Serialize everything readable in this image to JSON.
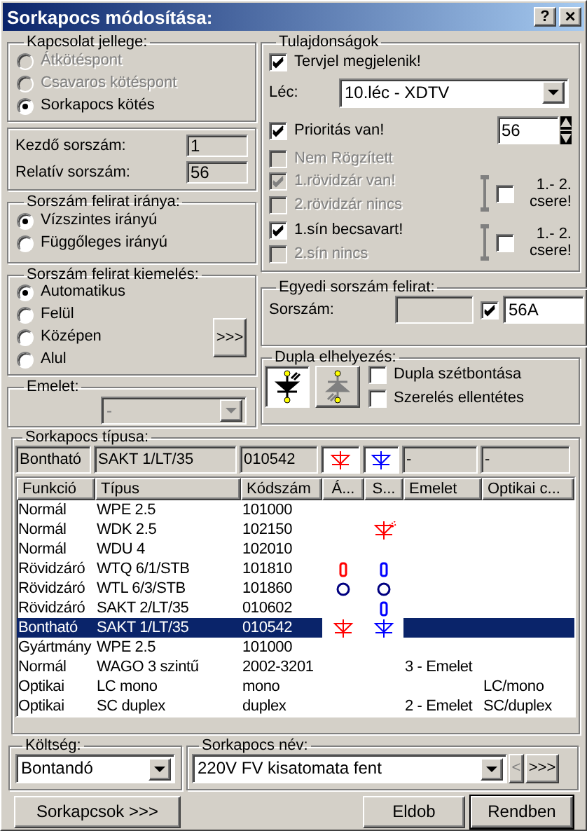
{
  "window": {
    "title": "Sorkapocs módosítása:",
    "help_button": "?",
    "close_button": "×"
  },
  "connection": {
    "title": "Kapcsolat jellege:",
    "options": [
      {
        "label": "Átkötéspont",
        "selected": false,
        "disabled": true
      },
      {
        "label": "Csavaros kötéspont",
        "selected": false,
        "disabled": true
      },
      {
        "label": "Sorkapocs kötés",
        "selected": true,
        "disabled": false
      }
    ]
  },
  "numbers": [
    {
      "label": "Kezdő sorszám:",
      "value": "1"
    },
    {
      "label": "Relatív sorszám:",
      "value": "56"
    }
  ],
  "direction": {
    "title": "Sorszám felirat iránya:",
    "options": [
      {
        "label": "Vízszintes irányú",
        "selected": true
      },
      {
        "label": "Függőleges irányú",
        "selected": false
      }
    ]
  },
  "emphasis": {
    "title": "Sorszám felirat kiemelés:",
    "more_button": ">>>",
    "options": [
      {
        "label": "Automatikus",
        "selected": true
      },
      {
        "label": "Felül",
        "selected": false
      },
      {
        "label": "Középen",
        "selected": false
      },
      {
        "label": "Alul",
        "selected": false
      }
    ]
  },
  "floor": {
    "title": "Emelet:",
    "value": "-",
    "disabled": true
  },
  "properties": {
    "title": "Tulajdonságok",
    "show_mark": {
      "label": "Tervjel megjelenik!",
      "checked": true,
      "disabled": false
    },
    "strip": {
      "label": "Léc:",
      "value": "10.léc - XDTV"
    },
    "priority": {
      "label": "Prioritás van!",
      "checked": true,
      "disabled": false,
      "value": "56"
    },
    "not_fixed": {
      "label": "Nem Rögzített",
      "checked": false,
      "disabled": true
    },
    "pairs": [
      {
        "items": [
          {
            "label": "1.rövidzár van!",
            "checked": true,
            "disabled": true
          },
          {
            "label": "2.rövidzár nincs",
            "checked": false,
            "disabled": true
          }
        ],
        "swap": {
          "label": "1.- 2. csere!",
          "checked": false
        }
      },
      {
        "items": [
          {
            "label": "1.sín becsavart!",
            "checked": true,
            "disabled": false
          },
          {
            "label": "2.sín nincs",
            "checked": false,
            "disabled": true
          }
        ],
        "swap": {
          "label": "1.- 2. csere!",
          "checked": false
        }
      }
    ]
  },
  "unique_label": {
    "title": "Egyedi sorszám felirat:",
    "label": "Sorszám:",
    "checked": true,
    "value": "56A"
  },
  "double": {
    "title": "Dupla elhelyezés:",
    "tools": [
      {
        "selected": true
      },
      {
        "selected": false
      }
    ],
    "options": [
      {
        "label": "Dupla szétbontása",
        "checked": false
      },
      {
        "label": "Szerelés ellentétes",
        "checked": false
      }
    ]
  },
  "terminal_type": {
    "title": "Sorkapocs típusa:",
    "current": {
      "function": "Bontható",
      "type": "SAKT 1/LT/35",
      "code": "010542",
      "a": {
        "kind": "diode",
        "color": "#ff0000"
      },
      "s": {
        "kind": "diode",
        "color": "#0000ff"
      },
      "floor": "-",
      "optical": "-"
    },
    "columns": [
      "Funkció",
      "Típus",
      "Kódszám",
      "Á...",
      "S...",
      "Emelet",
      "Optikai c..."
    ],
    "rows": [
      {
        "function": "Normál",
        "type": "WPE 2.5",
        "code": "101000",
        "selected": false
      },
      {
        "function": "Normál",
        "type": "WDK 2.5",
        "code": "102150",
        "s": {
          "kind": "led",
          "color": "#ff0000"
        },
        "selected": false
      },
      {
        "function": "Normál",
        "type": "WDU 4",
        "code": "102010",
        "selected": false
      },
      {
        "function": "Rövidzáró",
        "type": "WTQ 6/1/STB",
        "code": "101810",
        "a": {
          "kind": "fuse",
          "color": "#ff0000"
        },
        "s": {
          "kind": "fuse",
          "color": "#0000ff"
        },
        "selected": false
      },
      {
        "function": "Rövidzáró",
        "type": "WTL 6/3/STB",
        "code": "101860",
        "a": {
          "kind": "ring",
          "color": "#000080"
        },
        "s": {
          "kind": "ring",
          "color": "#000080"
        },
        "selected": false
      },
      {
        "function": "Rövidzáró",
        "type": "SAKT 2/LT/35",
        "code": "010602",
        "s": {
          "kind": "fuse",
          "color": "#0000ff"
        },
        "selected": false
      },
      {
        "function": "Bontható",
        "type": "SAKT 1/LT/35",
        "code": "010542",
        "a": {
          "kind": "diode",
          "color": "#ff0000"
        },
        "s": {
          "kind": "diode",
          "color": "#0000ff"
        },
        "selected": true
      },
      {
        "function": "Gyártmány",
        "type": "WPE 2.5",
        "code": "101000",
        "selected": false
      },
      {
        "function": "Normál",
        "type": "WAGO 3 szintű",
        "code": "2002-3201",
        "floor": "3 - Emelet",
        "selected": false
      },
      {
        "function": "Optikai",
        "type": "LC mono",
        "code": "mono",
        "optical": "LC/mono",
        "selected": false
      },
      {
        "function": "Optikai",
        "type": "SC duplex",
        "code": "duplex",
        "floor": "2 - Emelet",
        "optical": "SC/duplex",
        "selected": false
      }
    ]
  },
  "cost": {
    "title": "Költség:",
    "value": "Bontandó"
  },
  "terminal_name": {
    "title": "Sorkapocs név:",
    "value": "220V FV kisatomata fent",
    "prev_button": "<",
    "next_button": ">>>"
  },
  "buttons": [
    {
      "label": "Sorkapcsok >>>",
      "default": false
    },
    {
      "label": "Eldob",
      "default": false
    },
    {
      "label": "Rendben",
      "default": true
    }
  ]
}
